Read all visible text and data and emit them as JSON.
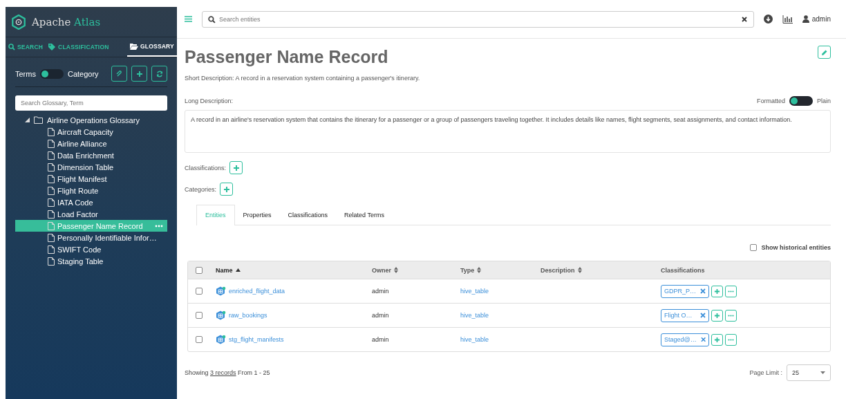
{
  "brand": {
    "first": "Apache",
    "second": "Atlas"
  },
  "nav_tabs": [
    {
      "label": "SEARCH",
      "kind": "search",
      "selected": false
    },
    {
      "label": "CLASSIFICATION",
      "kind": "tag",
      "selected": false
    },
    {
      "label": "GLOSSARY",
      "kind": "folder",
      "selected": true
    }
  ],
  "mode_toggle": {
    "left": "Terms",
    "right": "Category",
    "on": false
  },
  "glossary_search": {
    "placeholder": "Search Glossary, Term"
  },
  "tree": {
    "label": "Airline Operations Glossary",
    "expanded": true,
    "children": [
      {
        "label": "Aircraft Capacity",
        "selected": false
      },
      {
        "label": "Airline Alliance",
        "selected": false
      },
      {
        "label": "Data Enrichment",
        "selected": false
      },
      {
        "label": "Dimension Table",
        "selected": false
      },
      {
        "label": "Flight Manifest",
        "selected": false
      },
      {
        "label": "Flight Route",
        "selected": false
      },
      {
        "label": "IATA Code",
        "selected": false
      },
      {
        "label": "Load Factor",
        "selected": false
      },
      {
        "label": "Passenger Name Record",
        "selected": true
      },
      {
        "label": "Personally Identifiable Infor…",
        "selected": false
      },
      {
        "label": "SWIFT Code",
        "selected": false
      },
      {
        "label": "Staging Table",
        "selected": false
      }
    ]
  },
  "top_search": {
    "placeholder": "Search entities"
  },
  "user": "admin",
  "title": "Passenger Name Record",
  "short_description": "Short Description: A record in a reservation system containing a passenger's itinerary.",
  "long_description_label": "Long Description:",
  "format_toggle": {
    "left": "Formatted",
    "right": "Plain",
    "on": false
  },
  "long_description": "A record in an airline's reservation system that contains the itinerary for a passenger or a group of passengers traveling together. It includes details like names, flight segments, seat assignments, and contact information.",
  "classifications_label": "Classifications:",
  "categories_label": "Categories:",
  "detail_tabs": [
    {
      "label": "Entities",
      "selected": true
    },
    {
      "label": "Properties",
      "selected": false
    },
    {
      "label": "Classifications",
      "selected": false
    },
    {
      "label": "Related Terms",
      "selected": false
    }
  ],
  "show_historical": {
    "label": "Show historical entities",
    "checked": false
  },
  "table": {
    "select_all": false,
    "columns": [
      {
        "label": "Name",
        "sortable": true,
        "sorted": true
      },
      {
        "label": "Owner",
        "sortable": true,
        "sorted": false
      },
      {
        "label": "Type",
        "sortable": true,
        "sorted": false
      },
      {
        "label": "Description",
        "sortable": true,
        "sorted": false
      },
      {
        "label": "Classifications",
        "sortable": false,
        "sorted": false
      }
    ],
    "rows": [
      {
        "checked": false,
        "name": "enriched_flight_data",
        "owner": "admin",
        "type": "hive_table",
        "classification": "GDPR_P…"
      },
      {
        "checked": false,
        "name": "raw_bookings",
        "owner": "admin",
        "type": "hive_table",
        "classification": "Flight O…"
      },
      {
        "checked": false,
        "name": "stg_flight_manifests",
        "owner": "admin",
        "type": "hive_table",
        "classification": "Staged@…"
      }
    ]
  },
  "footer": {
    "prefix": "Showing",
    "link": "3 records",
    "suffix": "From 1 - 25",
    "page_limit_label": "Page Limit :",
    "page_limit": "25"
  }
}
